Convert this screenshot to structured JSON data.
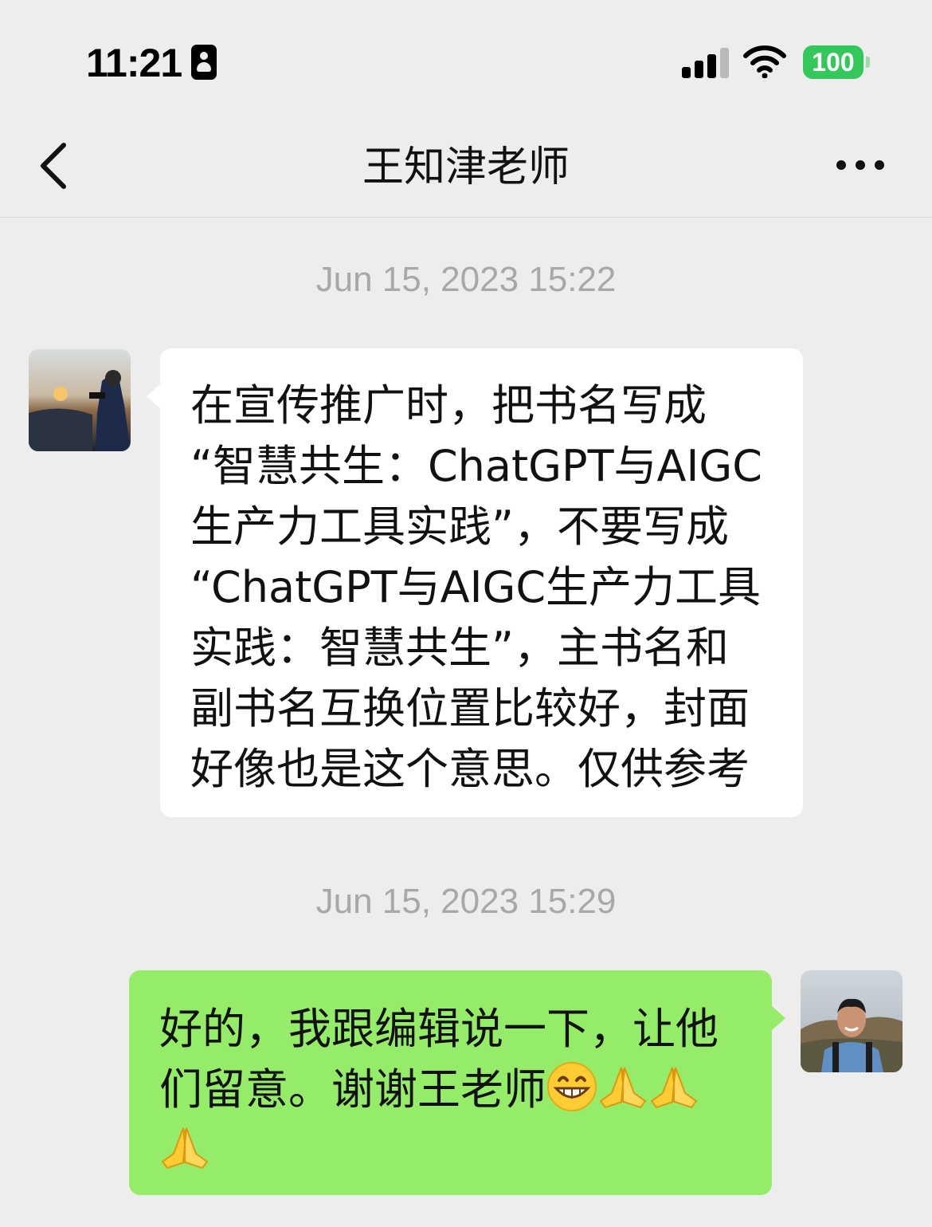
{
  "status_bar": {
    "time": "11:21",
    "battery": "100",
    "id_icon": "person-card-icon",
    "signal_icon": "cellular-signal-icon",
    "wifi_icon": "wifi-icon"
  },
  "nav": {
    "title": "王知津老师",
    "back_icon": "chevron-left-icon",
    "more_icon": "more-dots-icon"
  },
  "messages": [
    {
      "timestamp": "Jun 15, 2023 15:22",
      "direction": "incoming",
      "lines": [
        "在宣传推广时，把书名写成",
        "“智慧共生：ChatGPT与AIGC",
        "生产力工具实践”，不要写成",
        "“ChatGPT与AIGC生产力工具",
        "实践：智慧共生”，主书名和",
        "副书名互换位置比较好，封面",
        "好像也是这个意思。仅供参考"
      ]
    },
    {
      "timestamp": "Jun 15, 2023 15:29",
      "direction": "outgoing",
      "lines": [
        "好的，我跟编辑说一下，让他",
        "们留意。谢谢王老师"
      ],
      "emojis": [
        "grinning-face-emoji",
        "folded-hands-emoji",
        "folded-hands-emoji",
        "folded-hands-emoji"
      ]
    }
  ],
  "colors": {
    "background": "#ededed",
    "incoming_bubble": "#ffffff",
    "outgoing_bubble": "#95ec69",
    "timestamp_text": "#a8a8a8",
    "battery": "#34c759"
  }
}
